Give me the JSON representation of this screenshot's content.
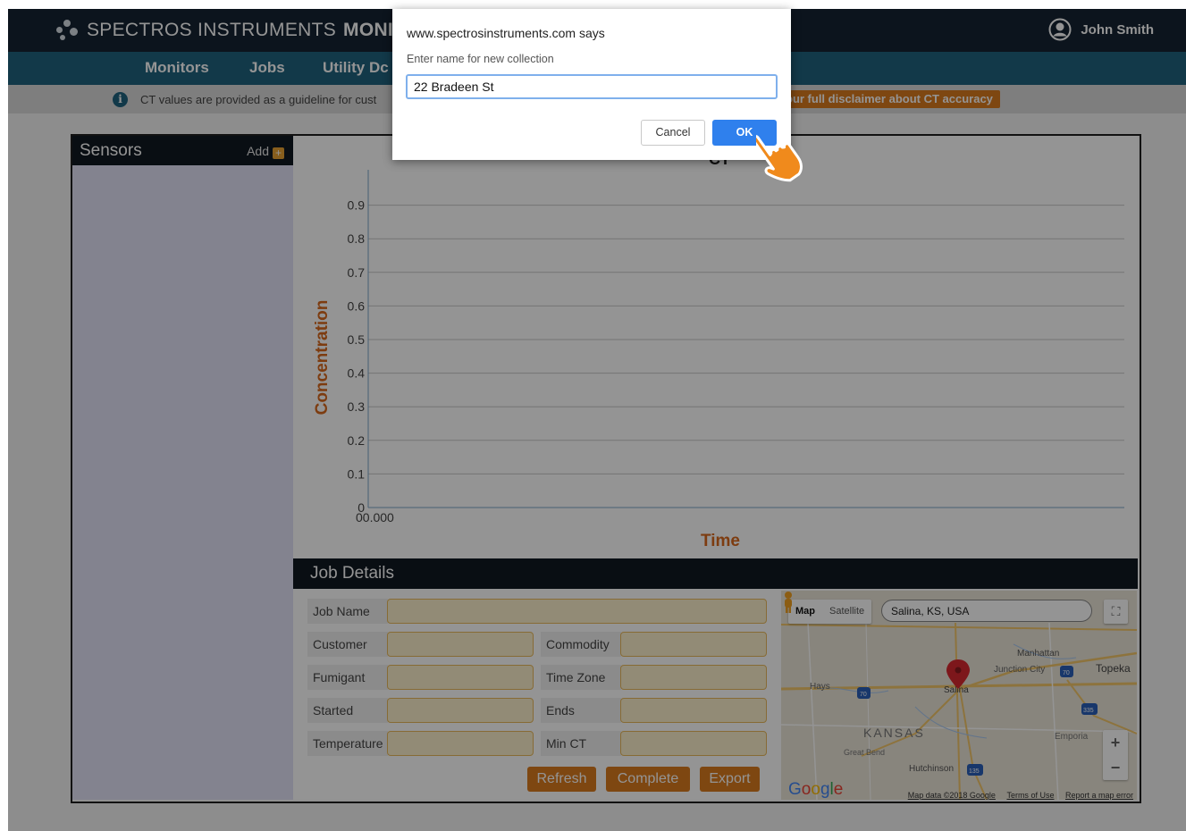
{
  "header": {
    "brand_light": "SPECTROS INSTRUMENTS",
    "brand_bold": "MONITO",
    "user_name": "John Smith"
  },
  "nav": {
    "items": [
      "Monitors",
      "Jobs",
      "Utility Dc"
    ]
  },
  "info_bar": {
    "text": "CT values are provided as a guideline for cust",
    "link": "our full disclaimer about CT accuracy"
  },
  "sensors": {
    "title": "Sensors",
    "add_label": "Add"
  },
  "chart_data": {
    "type": "line",
    "title": "CT",
    "xlabel": "Time",
    "ylabel": "Concentration",
    "x_ticks": [
      "00.000"
    ],
    "y_ticks": [
      "0",
      "0.1",
      "0.2",
      "0.3",
      "0.4",
      "0.5",
      "0.6",
      "0.7",
      "0.8",
      "0.9"
    ],
    "ylim": [
      0,
      1
    ],
    "series": [],
    "grid": true
  },
  "job_details": {
    "title": "Job Details",
    "fields": {
      "job_name": "Job Name",
      "customer": "Customer",
      "commodity": "Commodity",
      "fumigant": "Fumigant",
      "time_zone": "Time Zone",
      "started": "Started",
      "ends": "Ends",
      "temperature": "Temperature",
      "min_ct": "Min CT"
    },
    "buttons": {
      "refresh": "Refresh",
      "complete": "Complete",
      "export": "Export"
    }
  },
  "map": {
    "type_map": "Map",
    "type_satellite": "Satellite",
    "search_value": "Salina, KS, USA",
    "labels": {
      "manhattan": "Manhattan",
      "junction_city": "Junction City",
      "topeka": "Topeka",
      "hays": "Hays",
      "salina": "Salina",
      "kansas": "KANSAS",
      "great_bend": "Great Bend",
      "emporia": "Emporia",
      "hutchinson": "Hutchinson"
    },
    "shields": {
      "i70a": "70",
      "i70b": "70",
      "i70c": "70",
      "i335": "335",
      "i135": "135"
    },
    "google": "Google",
    "footer": {
      "data": "Map data ©2018 Google",
      "terms": "Terms of Use",
      "report": "Report a map error"
    }
  },
  "dialog": {
    "title": "www.spectrosinstruments.com says",
    "message": "Enter name for new collection",
    "input_value": "22 Bradeen St",
    "cancel_label": "Cancel",
    "ok_label": "OK"
  },
  "colors": {
    "topbar": "#152433",
    "navbar": "#20627f",
    "accent_orange": "#d97a1e",
    "field_fill": "#fbefcc",
    "dialog_ok": "#2f80ed"
  }
}
